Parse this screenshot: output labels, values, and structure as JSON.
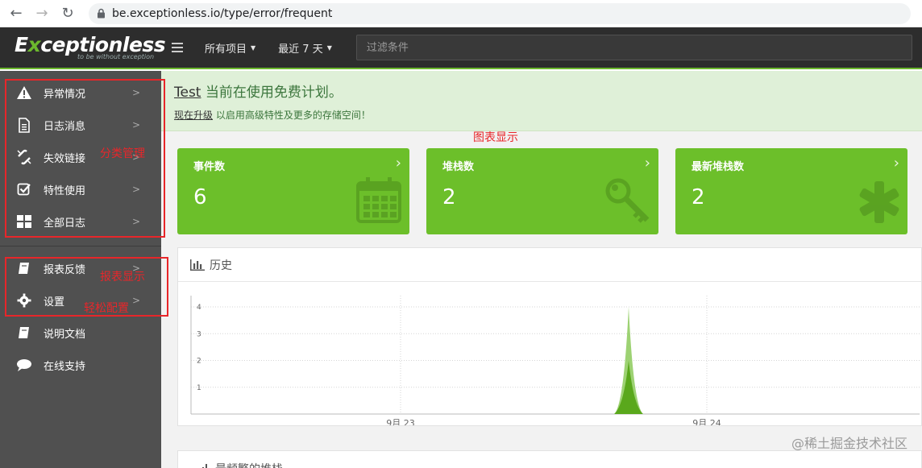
{
  "browser": {
    "url": "be.exceptionless.io/type/error/frequent"
  },
  "header": {
    "logo_lead": "E",
    "logo_accent": "x",
    "logo_rest": "ceptionless",
    "logo_tagline": "to be without exception",
    "projects_label": "所有项目",
    "range_label": "最近 7 天",
    "filter_placeholder": "过滤条件"
  },
  "sidebar": {
    "items": [
      {
        "label": "异常情况",
        "icon": "warning-icon"
      },
      {
        "label": "日志消息",
        "icon": "document-icon"
      },
      {
        "label": "失效链接",
        "icon": "broken-link-icon"
      },
      {
        "label": "特性使用",
        "icon": "checkbox-icon"
      },
      {
        "label": "全部日志",
        "icon": "grid-icon"
      }
    ],
    "lower_items": [
      {
        "label": "报表反馈",
        "icon": "book-icon"
      },
      {
        "label": "设置",
        "icon": "gear-icon"
      },
      {
        "label": "说明文档",
        "icon": "book-icon"
      },
      {
        "label": "在线支持",
        "icon": "chat-icon"
      }
    ]
  },
  "annotations": {
    "category": "分类管理",
    "reports": "报表显示",
    "config": "轻松配置",
    "chart": "图表显示"
  },
  "banner": {
    "account": "Test",
    "title": "当前在使用免费计划。",
    "upgrade_link": "现在升级",
    "subtitle": "以启用高级特性及更多的存储空间！"
  },
  "stats": [
    {
      "label": "事件数",
      "value": "6",
      "icon": "calendar-icon"
    },
    {
      "label": "堆栈数",
      "value": "2",
      "icon": "key-icon"
    },
    {
      "label": "最新堆栈数",
      "value": "2",
      "icon": "asterisk-icon"
    }
  ],
  "history": {
    "title": "历史"
  },
  "chart_data": {
    "type": "area",
    "y_ticks": [
      1,
      2,
      3,
      4
    ],
    "x_ticks": [
      "9月 23",
      "9月 24"
    ],
    "ylim": [
      0,
      4
    ],
    "series": [
      {
        "values": [
          0,
          0,
          0,
          0,
          4,
          0,
          0,
          0,
          0,
          0
        ],
        "color": "#8cca5a"
      },
      {
        "values": [
          0,
          0,
          0,
          0,
          2,
          0,
          0,
          0,
          0,
          0
        ],
        "color": "#5aa81c"
      }
    ]
  },
  "frequent": {
    "title": "最频繁的堆栈"
  },
  "watermark": "@稀土掘金技术社区"
}
